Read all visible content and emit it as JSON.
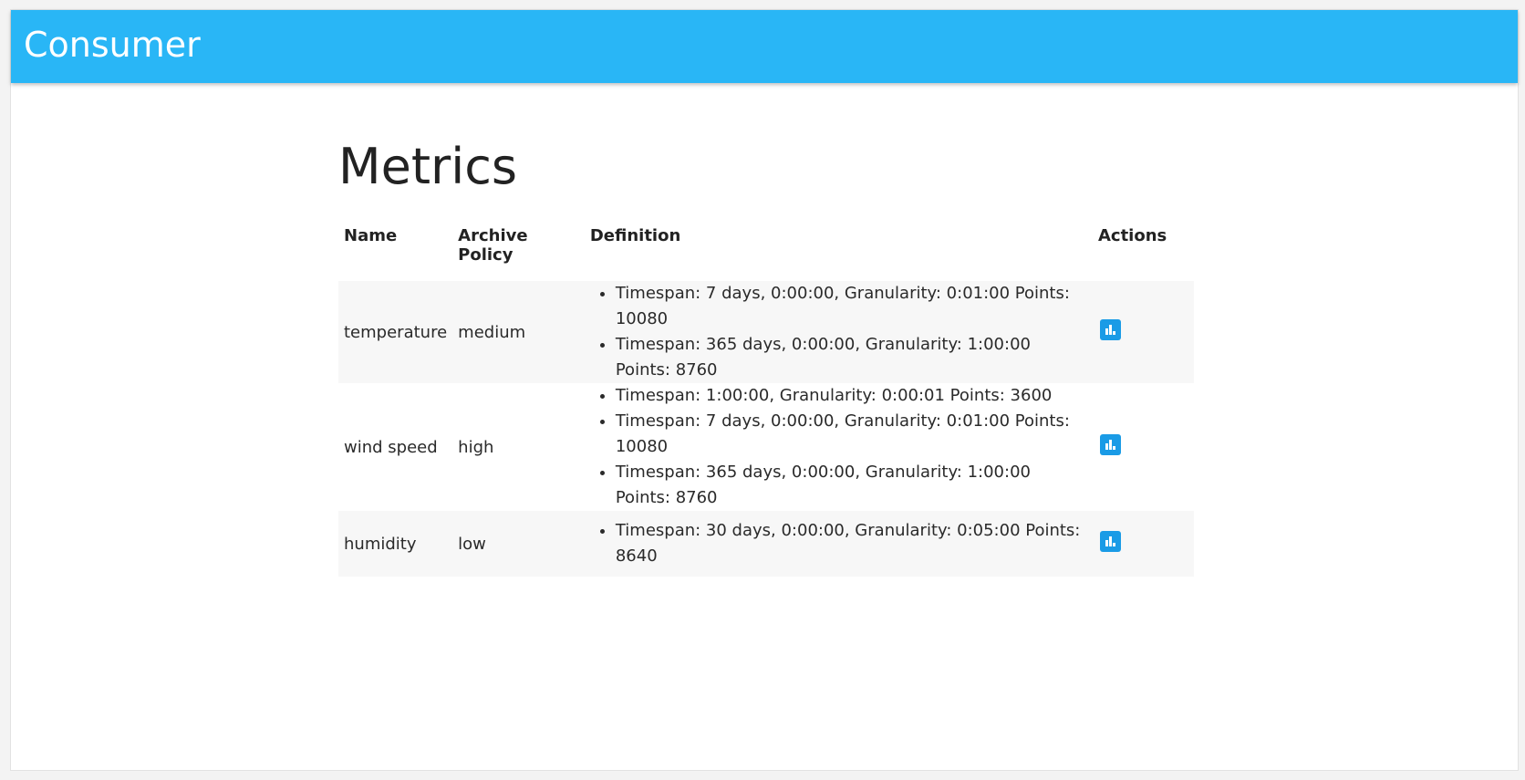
{
  "header": {
    "title": "Consumer"
  },
  "page": {
    "title": "Metrics"
  },
  "table": {
    "columns": [
      "Name",
      "Archive Policy",
      "Definition",
      "Actions"
    ],
    "rows": [
      {
        "name": "temperature",
        "archive_policy": "medium",
        "definition": [
          "Timespan: 7 days, 0:00:00, Granularity: 0:01:00 Points: 10080",
          "Timespan: 365 days, 0:00:00, Granularity: 1:00:00 Points: 8760"
        ],
        "action_icon": "bar-chart-icon"
      },
      {
        "name": "wind speed",
        "archive_policy": "high",
        "definition": [
          "Timespan: 1:00:00, Granularity: 0:00:01 Points: 3600",
          "Timespan: 7 days, 0:00:00, Granularity: 0:01:00 Points: 10080",
          "Timespan: 365 days, 0:00:00, Granularity: 1:00:00 Points: 8760"
        ],
        "action_icon": "bar-chart-icon"
      },
      {
        "name": "humidity",
        "archive_policy": "low",
        "definition": [
          "Timespan: 30 days, 0:00:00, Granularity: 0:05:00 Points: 8640"
        ],
        "action_icon": "bar-chart-icon"
      }
    ]
  },
  "colors": {
    "appbar": "#29b6f6",
    "action_icon": "#1a9be6",
    "row_shade": "#f7f7f7"
  }
}
